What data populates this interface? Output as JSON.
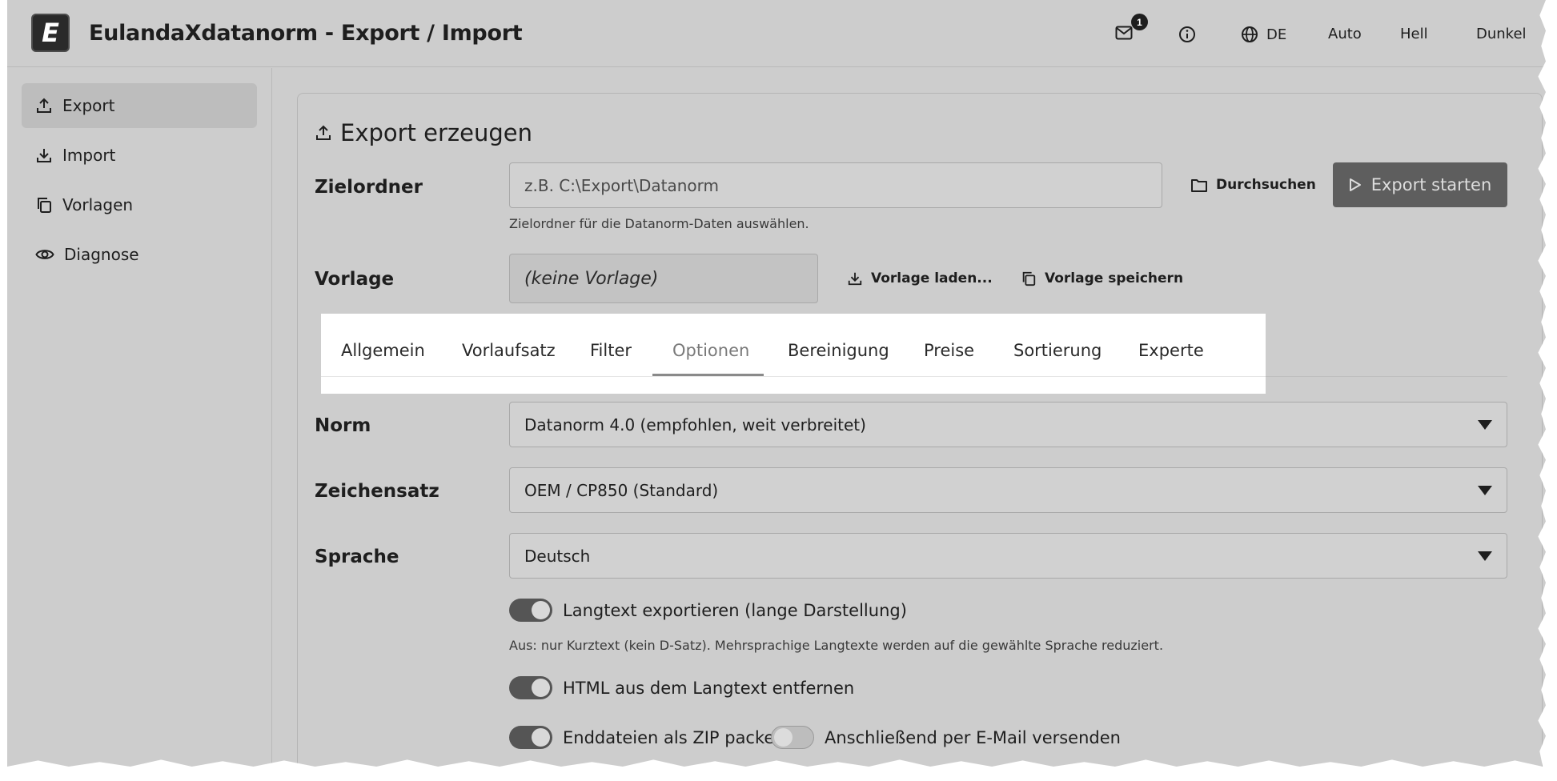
{
  "header": {
    "app_title": "EulandaXdatanorm - Export / Import",
    "logo_letter": "E",
    "mail_badge": "1",
    "language": "DE",
    "theme_auto": "Auto",
    "theme_light": "Hell",
    "theme_dark": "Dunkel"
  },
  "sidebar": {
    "items": [
      {
        "label": "Export",
        "icon": "upload-icon",
        "active": true
      },
      {
        "label": "Import",
        "icon": "download-icon",
        "active": false
      },
      {
        "label": "Vorlagen",
        "icon": "copy-icon",
        "active": false
      },
      {
        "label": "Diagnose",
        "icon": "eye-icon",
        "active": false
      }
    ]
  },
  "main": {
    "section_title": "Export erzeugen",
    "target_folder": {
      "label": "Zielordner",
      "placeholder": "z.B. C:\\Export\\Datanorm",
      "helper": "Zielordner für die Datanorm-Daten auswählen.",
      "browse_label": "Durchsuchen"
    },
    "start_export_label": "Export starten",
    "template": {
      "label": "Vorlage",
      "value": "(keine Vorlage)",
      "load_label": "Vorlage laden...",
      "save_label": "Vorlage speichern"
    },
    "tabs": [
      {
        "label": "Allgemein"
      },
      {
        "label": "Vorlaufsatz"
      },
      {
        "label": "Filter"
      },
      {
        "label": "Optionen",
        "active": true
      },
      {
        "label": "Bereinigung"
      },
      {
        "label": "Preise"
      },
      {
        "label": "Sortierung"
      },
      {
        "label": "Experte"
      }
    ],
    "options": {
      "norm": {
        "label": "Norm",
        "value": "Datanorm 4.0 (empfohlen, weit verbreitet)"
      },
      "charset": {
        "label": "Zeichensatz",
        "value": "OEM / CP850 (Standard)"
      },
      "language": {
        "label": "Sprache",
        "value": "Deutsch"
      },
      "toggles": {
        "longtext": {
          "label": "Langtext exportieren (lange Darstellung)",
          "on": true
        },
        "longtext_helper": "Aus: nur Kurztext (kein D-Satz). Mehrsprachige Langtexte werden auf die gewählte Sprache reduziert.",
        "strip_html": {
          "label": "HTML aus dem Langtext entfernen",
          "on": true
        },
        "zip": {
          "label": "Enddateien als ZIP packen",
          "on": true
        },
        "email": {
          "label": "Anschließend per E-Mail versenden",
          "on": false
        }
      }
    }
  }
}
